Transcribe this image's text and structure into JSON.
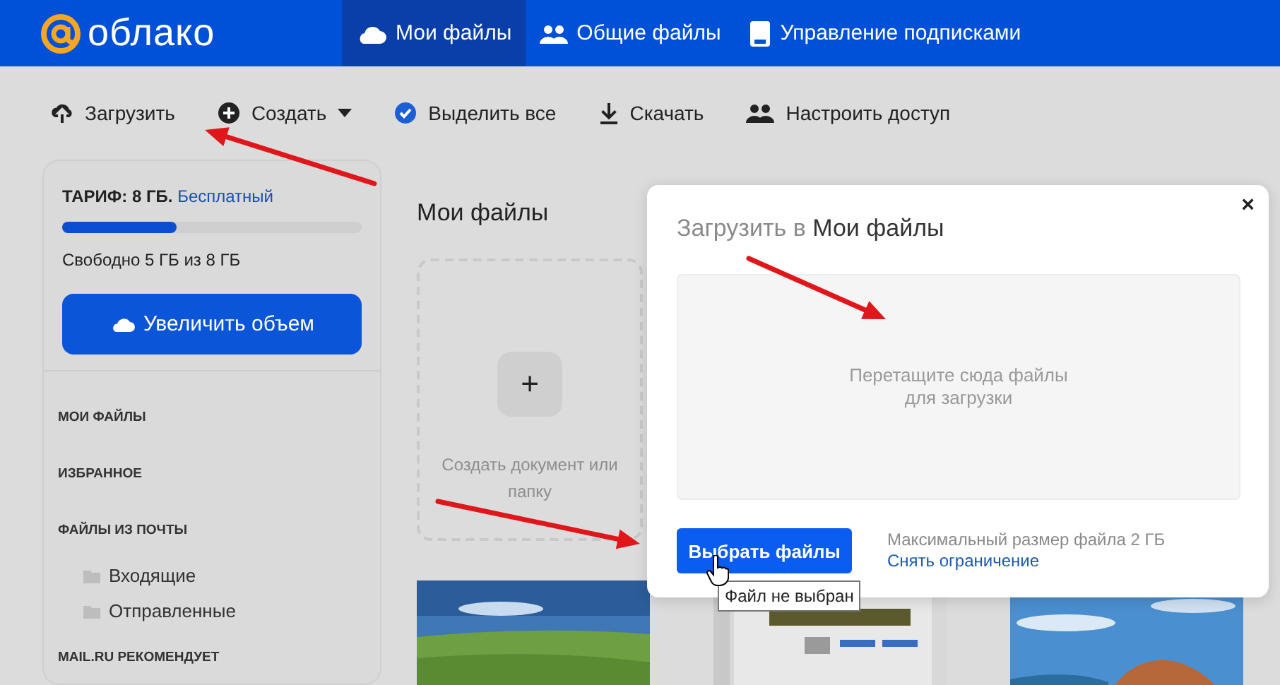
{
  "header": {
    "logo": "облако",
    "tabs": [
      {
        "label": "Мои файлы",
        "selected": true
      },
      {
        "label": "Общие файлы",
        "selected": false
      },
      {
        "label": "Управление подписками",
        "selected": false
      }
    ]
  },
  "toolbar": [
    {
      "label": "Загрузить",
      "dropdown": false
    },
    {
      "label": "Создать",
      "dropdown": true
    },
    {
      "label": "Выделить все",
      "dropdown": false
    },
    {
      "label": "Скачать",
      "dropdown": false
    },
    {
      "label": "Настроить доступ",
      "dropdown": false
    }
  ],
  "sidebar": {
    "plan_label": "ТАРИФ: 8 ГБ.",
    "plan_name": "Бесплатный",
    "level": 0.38,
    "free_text": "Свободно 5 ГБ из 8 ГБ",
    "upgrade_button": "Увеличить объем",
    "items": [
      {
        "label": "МОИ ФАЙЛЫ"
      },
      {
        "label": "ИЗБРАННОЕ"
      },
      {
        "label": "ФАЙЛЫ ИЗ ПОЧТЫ",
        "children": [
          {
            "label": "Входящие"
          },
          {
            "label": "Отправленные"
          }
        ]
      },
      {
        "label": "MAIL.RU РЕКОМЕНДУЕТ"
      }
    ]
  },
  "main": {
    "title": "Мои файлы",
    "create_tile": {
      "icon_text": "+",
      "label": "Создать документ или папку"
    }
  },
  "dialog": {
    "title_prefix": "Загрузить в",
    "title_folder": "Мои файлы",
    "close": "×",
    "drop_hint": "Перетащите сюда файлы для загрузки",
    "choose_button": "Выбрать файлы",
    "max_size": "Максимальный размер файла 2 ГБ",
    "remove_limit_link": "Снять ограничение",
    "tooltip": "Файл не выбран"
  }
}
